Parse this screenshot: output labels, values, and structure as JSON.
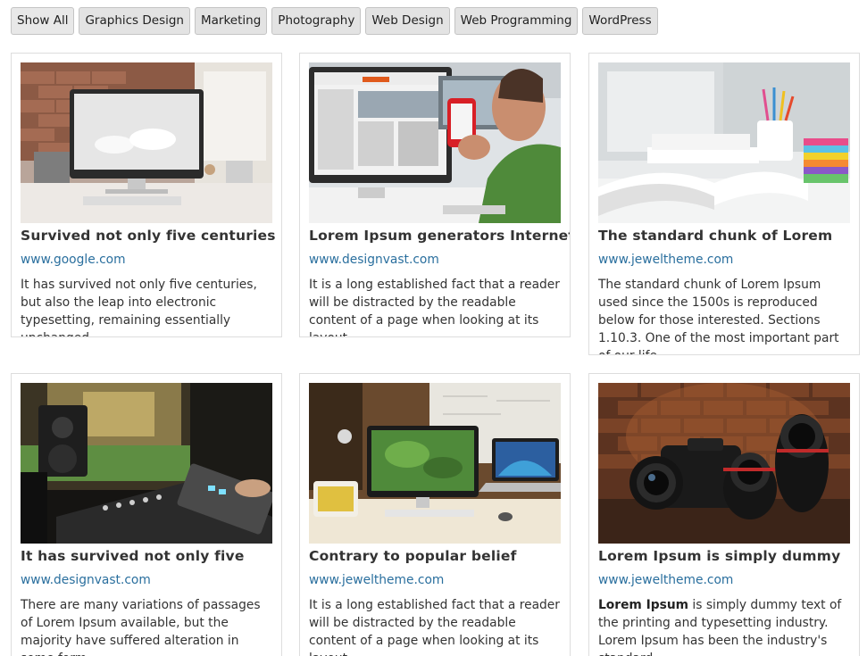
{
  "filters": [
    {
      "label": "Show All"
    },
    {
      "label": "Graphics Design"
    },
    {
      "label": "Marketing"
    },
    {
      "label": "Photography"
    },
    {
      "label": "Web Design"
    },
    {
      "label": "Web Programming"
    },
    {
      "label": "WordPress"
    }
  ],
  "cards": [
    {
      "image": "imac-desk-photo",
      "title": "Survived not only five centuries",
      "link": "www.google.com",
      "desc": "It has survived not only five centuries, but also the leap into electronic typesetting, remaining essentially unchanged."
    },
    {
      "image": "man-phone-imac-photo",
      "title": "Lorem Ipsum generators Internet",
      "link": "www.designvast.com",
      "desc": "It is a long established fact that a reader will be distracted by the readable content of a page when looking at its layout."
    },
    {
      "image": "open-book-desk-photo",
      "title": "The standard chunk of Lorem",
      "link": "www.jeweltheme.com",
      "desc": "The standard chunk of Lorem Ipsum used since the 1500s is reproduced below for those interested. Sections 1.10.3. One of the most important part of our life."
    },
    {
      "image": "music-studio-photo",
      "title": "It has survived not only five",
      "link": "www.designvast.com",
      "desc": "There are many variations of passages of Lorem Ipsum available, but the majority have suffered alteration in some form."
    },
    {
      "image": "workspace-desk-photo",
      "title": "Contrary to popular belief",
      "link": "www.jeweltheme.com",
      "desc": "It is a long established fact that a reader will be distracted by the readable content of a page when looking at its layout."
    },
    {
      "image": "cameras-brick-photo",
      "title": "Lorem Ipsum is simply dummy",
      "link": "www.jeweltheme.com",
      "desc_bold": "Lorem Ipsum",
      "desc": " is simply dummy text of the printing and typesetting industry. Lorem Ipsum has been the industry's standard."
    }
  ]
}
